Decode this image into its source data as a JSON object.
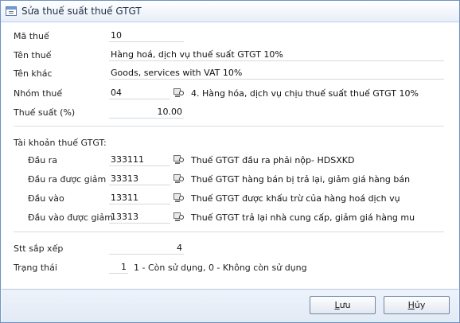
{
  "window": {
    "title": "Sửa thuế suất thuế GTGT"
  },
  "form": {
    "ma_thue": {
      "label": "Mã thuế",
      "value": "10"
    },
    "ten_thue": {
      "label": "Tên thuế",
      "value": "Hàng hoá, dịch vụ thuế suất GTGT 10%"
    },
    "ten_khac": {
      "label": "Tên khác",
      "value": "Goods, services with VAT 10%"
    },
    "nhom_thue": {
      "label": "Nhóm thuế",
      "value": "04",
      "description": "4. Hàng hóa, dịch vụ chịu thuế suất thuế GTGT 10%"
    },
    "thue_suat": {
      "label": "Thuế suất (%)",
      "value": "10.00"
    },
    "tai_khoan": {
      "heading": "Tài khoản thuế GTGT:",
      "dau_ra": {
        "label": "Đầu ra",
        "value": "333111",
        "description": "Thuế GTGT đầu ra phải nộp- HDSXKD"
      },
      "dau_ra_duoc_giam": {
        "label": "Đầu ra được giảm",
        "value": "33313",
        "description": "Thuế GTGT hàng bán bị trả lại, giảm giá hàng bán"
      },
      "dau_vao": {
        "label": "Đầu vào",
        "value": "13311",
        "description": "Thuế GTGT được khấu trừ của hàng hoá dịch vụ"
      },
      "dau_vao_duoc_giam": {
        "label": "Đầu vào được giảm",
        "value": "13313",
        "description": "Thuế GTGT trả lại nhà cung cấp, giảm giá hàng mu"
      }
    },
    "stt_sap_xep": {
      "label": "Stt sắp xếp",
      "value": "4"
    },
    "trang_thai": {
      "label": "Trạng thái",
      "value": "1",
      "hint": "1 - Còn sử dụng, 0 - Không còn sử dụng"
    }
  },
  "buttons": {
    "save": {
      "accel": "L",
      "rest": "ưu"
    },
    "cancel": {
      "accel": "H",
      "rest": "ủy"
    }
  },
  "icons": {
    "lookup": "lookup-icon",
    "window": "form-icon"
  },
  "colors": {
    "title_bar": "#e7eef8",
    "border": "#6f93c2",
    "footer": "#e2eaf5"
  }
}
